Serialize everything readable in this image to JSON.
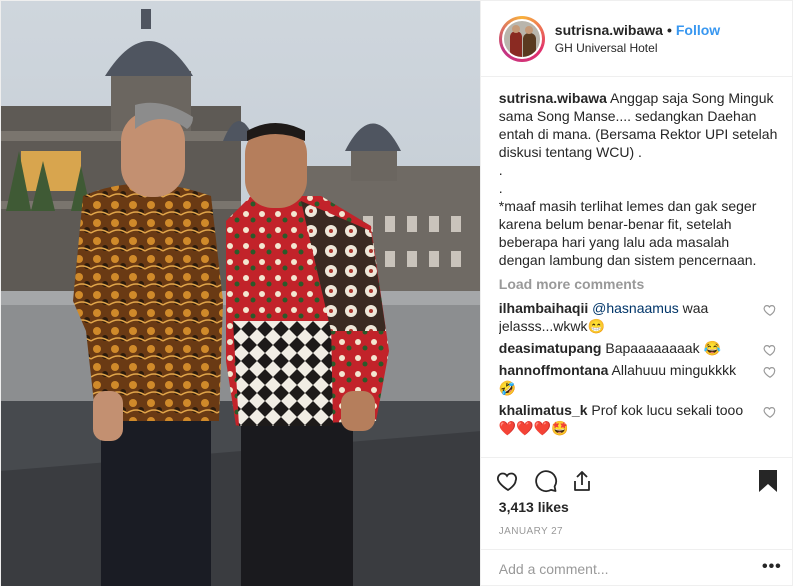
{
  "post": {
    "username": "sutrisna.wibawa",
    "separator": "•",
    "follow_label": "Follow",
    "location": "GH Universal Hotel"
  },
  "caption": {
    "username": "sutrisna.wibawa",
    "line1": " Anggap saja Song Minguk sama Song Manse.... sedangkan Daehan entah di mana. (Bersama Rektor UPI setelah diskusi tentang WCU) .",
    "dot1": ".",
    "dot2": ".",
    "line2": "*maaf masih terlihat lemes dan gak seger karena belum benar-benar fit, setelah beberapa hari yang lalu ada masalah dengan lambung dan sistem pencernaan."
  },
  "load_more_label": "Load more comments",
  "comments": [
    {
      "username": "ilhambaihaqii",
      "mention": "@hasnaamus",
      "text": " waa jelasss...wkwk😁"
    },
    {
      "username": "deasimatupang",
      "mention": "",
      "text": " Bapaaaaaaaak 😂"
    },
    {
      "username": "hannoffmontana",
      "mention": "",
      "text": " Allahuuu mingukkkk 🤣"
    },
    {
      "username": "khalimatus_k",
      "mention": "",
      "text": " Prof kok lucu sekali tooo ❤️❤️❤️🤩"
    }
  ],
  "actions": {
    "icons": [
      "heart-icon",
      "comment-icon",
      "share-icon",
      "bookmark-icon"
    ]
  },
  "likes_label": "3,413 likes",
  "date_label": "JANUARY 27",
  "comment_input": {
    "placeholder": "Add a comment...",
    "value": ""
  },
  "more_label": "•••",
  "colors": {
    "accent": "#3897f0",
    "text": "#262626",
    "muted": "#999999",
    "border": "#efefef"
  }
}
